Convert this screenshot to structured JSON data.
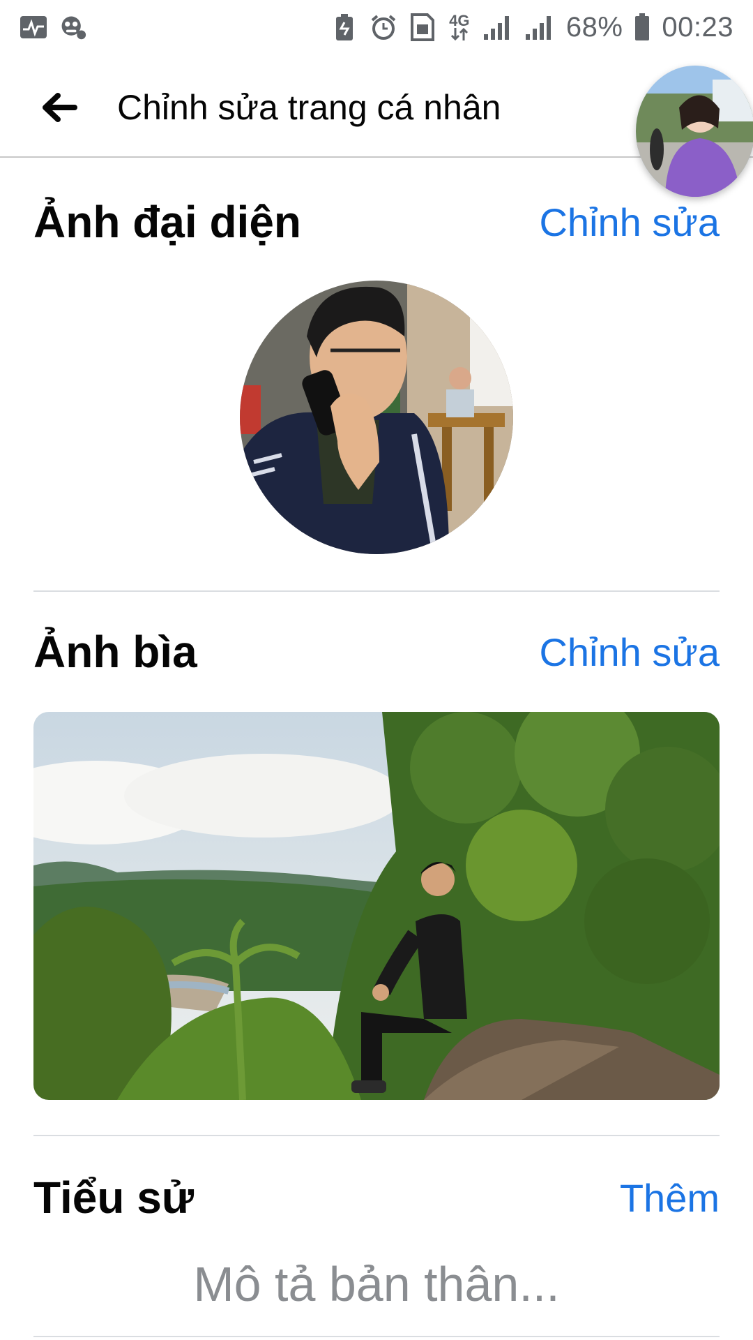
{
  "status_bar": {
    "left_icons": [
      "activity-monitor-icon",
      "sticker-app-icon"
    ],
    "right_icons": [
      "battery-saver-icon",
      "alarm-icon",
      "sim-card-icon",
      "data-4g-icon",
      "signal-icon",
      "signal-icon"
    ],
    "network": "4G",
    "battery": "68%",
    "time": "00:23"
  },
  "app_bar": {
    "back_icon": "arrow-left-icon",
    "title": "Chỉnh sửa trang cá nhân"
  },
  "profile_picture": {
    "title": "Ảnh đại diện",
    "action": "Chỉnh sửa"
  },
  "cover_photo": {
    "title": "Ảnh bìa",
    "action": "Chỉnh sửa"
  },
  "bio": {
    "title": "Tiểu sử",
    "action": "Thêm",
    "placeholder": "Mô tả bản thân..."
  },
  "colors": {
    "accent": "#1b74e4",
    "text": "#050505",
    "placeholder": "#8a8d91",
    "divider": "#dadde1"
  }
}
